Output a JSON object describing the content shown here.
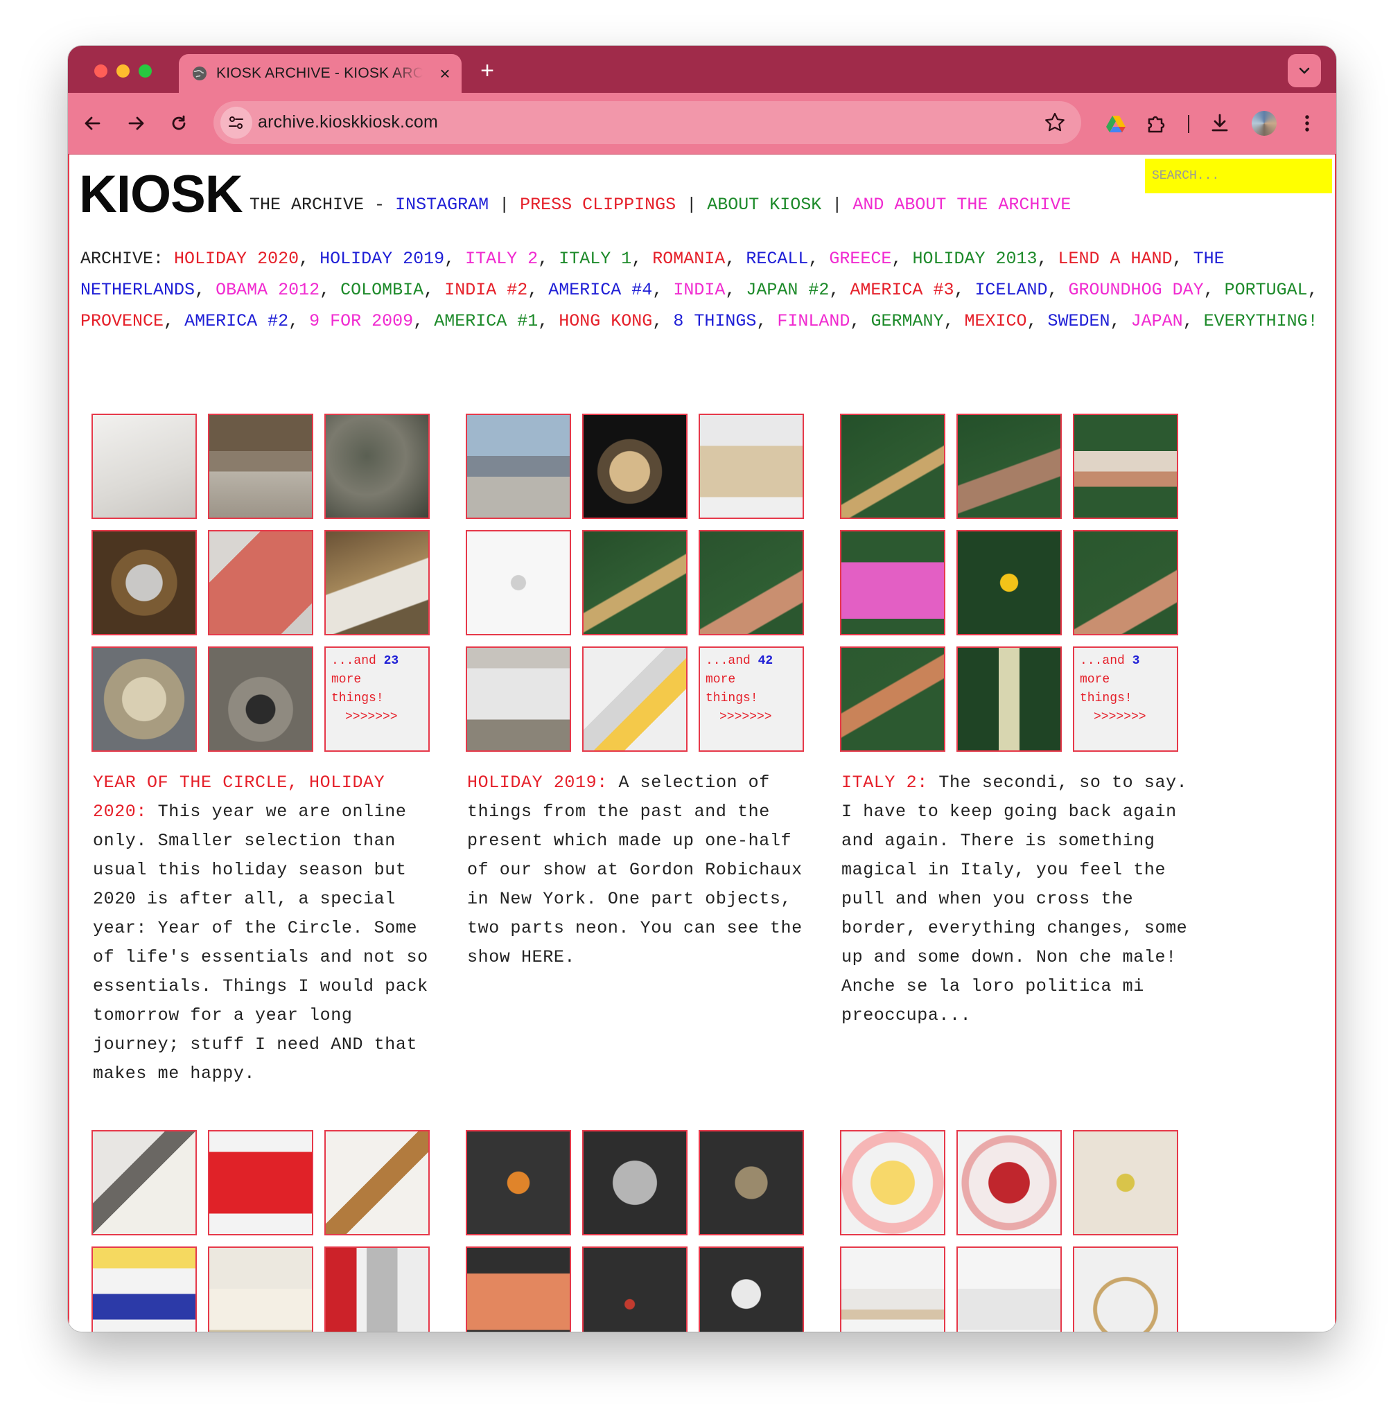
{
  "browser": {
    "tab_title": "KIOSK ARCHIVE - KIOSK ARCHIVE",
    "tab_close": "×",
    "new_tab": "+",
    "url": "archive.kioskkiosk.com"
  },
  "header": {
    "logo": "KIOSK",
    "subtitle": "THE ARCHIVE -",
    "links": [
      {
        "label": "INSTAGRAM",
        "color": "#1f1fd6"
      },
      {
        "label": "PRESS CLIPPINGS",
        "color": "#e5202a"
      },
      {
        "label": "ABOUT KIOSK",
        "color": "#1d8a2a"
      },
      {
        "label": "AND ABOUT THE ARCHIVE",
        "color": "#f02bd0"
      }
    ],
    "separator": "|",
    "search_placeholder": "SEARCH..."
  },
  "archive": {
    "label": "ARCHIVE:",
    "items": [
      {
        "label": "HOLIDAY 2020",
        "color": "#e5202a"
      },
      {
        "label": "HOLIDAY 2019",
        "color": "#1f1fd6"
      },
      {
        "label": "ITALY 2",
        "color": "#f02bd0"
      },
      {
        "label": "ITALY 1",
        "color": "#1d8a2a"
      },
      {
        "label": "ROMANIA",
        "color": "#e5202a"
      },
      {
        "label": "RECALL",
        "color": "#1f1fd6"
      },
      {
        "label": "GREECE",
        "color": "#f02bd0"
      },
      {
        "label": "HOLIDAY 2013",
        "color": "#1d8a2a"
      },
      {
        "label": "LEND A HAND",
        "color": "#e5202a"
      },
      {
        "label": "THE NETHERLANDS",
        "color": "#1f1fd6"
      },
      {
        "label": "OBAMA 2012",
        "color": "#f02bd0"
      },
      {
        "label": "COLOMBIA",
        "color": "#1d8a2a"
      },
      {
        "label": "INDIA #2",
        "color": "#e5202a"
      },
      {
        "label": "AMERICA #4",
        "color": "#1f1fd6"
      },
      {
        "label": "INDIA",
        "color": "#f02bd0"
      },
      {
        "label": "JAPAN #2",
        "color": "#1d8a2a"
      },
      {
        "label": "AMERICA #3",
        "color": "#e5202a"
      },
      {
        "label": "ICELAND",
        "color": "#1f1fd6"
      },
      {
        "label": "GROUNDHOG DAY",
        "color": "#f02bd0"
      },
      {
        "label": "PORTUGAL",
        "color": "#1d8a2a"
      },
      {
        "label": "PROVENCE",
        "color": "#e5202a"
      },
      {
        "label": "AMERICA #2",
        "color": "#1f1fd6"
      },
      {
        "label": "9 FOR 2009",
        "color": "#f02bd0"
      },
      {
        "label": "AMERICA #1",
        "color": "#1d8a2a"
      },
      {
        "label": "HONG KONG",
        "color": "#e5202a"
      },
      {
        "label": "8 THINGS",
        "color": "#1f1fd6"
      },
      {
        "label": "FINLAND",
        "color": "#f02bd0"
      },
      {
        "label": "GERMANY",
        "color": "#1d8a2a"
      },
      {
        "label": "MEXICO",
        "color": "#e5202a"
      },
      {
        "label": "SWEDEN",
        "color": "#1f1fd6"
      },
      {
        "label": "JAPAN",
        "color": "#f02bd0"
      },
      {
        "label": "EVERYTHING!",
        "color": "#1d8a2a"
      }
    ]
  },
  "collections": [
    {
      "heading": "YEAR OF THE CIRCLE, HOLIDAY 2020:",
      "text": " This year we are online only. Smaller selection than usual this holiday season but 2020 is after all, a special year: Year of the Circle. Some of life's essentials and not so essentials. Things I would pack tomorrow for a year long journey; stuff I need AND that makes me happy.",
      "more_prefix": "...and",
      "more_count": "23",
      "more_suffix": "more things!",
      "more_arrows": ">>>>>>>",
      "thumbs": [
        "linear-gradient(160deg,#f2f1ef,#dcdad6 60%,#c9c6c1)",
        "linear-gradient(180deg,#6b5a46 0 35%,#8a7c6b 35% 55%,#b9b3a8 55%,#9c9488)",
        "radial-gradient(circle at 40% 40%,#5a5f52,#7b7a6e 45%,#3e4238)",
        "radial-gradient(circle at 50% 50%,#c9c8c6 0 25%,#7a5b34 26% 45%,#4b3520 46%)",
        "linear-gradient(135deg,#d9d6d2 0 25%,#d46b5f 25% 85%,#cfccc8 85%)",
        "linear-gradient(160deg,#6a5236,#a38659 45%,#e8e4dc 46% 75%,#6b5a3f 76%)",
        "radial-gradient(circle at 50% 50%,#d9cfb3 0 30%,#a89c80 31% 55%,#6b6f74 56%)",
        "radial-gradient(circle at 50% 60%,#2b2b2b 0 18%,#8f8a80 19% 40%,#6e6a62 41%)",
        "more"
      ]
    },
    {
      "heading": "HOLIDAY 2019:",
      "text": " A selection of things from the past and the present which made up one-half of our show at Gordon Robichaux in New York. One part objects, two parts neon. You can see the show HERE.",
      "more_prefix": "...and",
      "more_count": "42",
      "more_suffix": "more things!",
      "more_arrows": ">>>>>>>",
      "thumbs": [
        "linear-gradient(180deg,#9fb7cc 0 40%,#7d8793 40% 60%,#b8b5ae 60%)",
        "radial-gradient(circle at 45% 55%,#d6b98a 0 25%,#5a4a36 26% 40%,#111 41%)",
        "linear-gradient(180deg,#e9e9ea 0 30%,#d9c7a6 30% 80%,#efefef 80%)",
        "radial-gradient(circle at 50% 50%,#cfcfcf 0 10%,#f7f7f7 11%)",
        "linear-gradient(150deg,#264e2a,#2f5d33 50%,#c8a86b 51% 62%,#2d5a31 63%)",
        "linear-gradient(150deg,#2a532e,#2f5e33 60%,#c98f70 61% 80%,#2b572f 81%)",
        "linear-gradient(180deg,#c7c3bd 0 20%,#e6e6e6 20% 70%,#8a8478 70%)",
        "linear-gradient(135deg,#efefef 0 40%,#d5d5d5 40% 55%,#f4c94a 55% 70%,#efefef 70%)",
        "more"
      ]
    },
    {
      "heading": "ITALY 2:",
      "text": " The secondi, so to say. I have to keep going back again and again. There is something magical in Italy, you feel the pull and when you cross the border, everything changes, some up and some down. Non che male! Anche se la loro politica mi preoccupa...",
      "more_prefix": "...and",
      "more_count": "3",
      "more_suffix": "more things!",
      "more_arrows": ">>>>>>>",
      "thumbs": [
        "linear-gradient(150deg,#24502a,#2e5b31 55%,#c9a66a 56% 66%,#2c5830 67%)",
        "linear-gradient(160deg,#24502a,#2d5a31 50%,#a77e66 51% 70%,#2b5830 71%)",
        "linear-gradient(180deg,#2c5930 0 35%,#e0d4c6 35% 55%,#c48b6d 55% 70%,#2c5930 70%)",
        "linear-gradient(180deg,#2c5930 0 30%,#e35fc4 30% 85%,#2c5930 85%)",
        "radial-gradient(circle at 50% 50%,#f2c319 0 12%,#1f4425 13%)",
        "linear-gradient(150deg,#2a572e,#2e5b31 60%,#c98f70 61% 80%,#2b572f 81%)",
        "linear-gradient(150deg,#2c5930,#2e5b31 40%,#c98359 41% 55%,#2c5930 56%)",
        "linear-gradient(90deg,#1f4425 0 40%,#d8d6b0 40% 60%,#1f4425 60%)",
        "more"
      ]
    }
  ],
  "bottom_rows": [
    [
      "linear-gradient(135deg,#e8e6e3 0 35%,#6a6763 35% 50%,#f1efe9 50%)",
      "linear-gradient(180deg,#f3f3f3 0 20%,#e02228 20% 80%,#f3f3f3 80%)",
      "linear-gradient(135deg,#f3f1ed 0 45%,#b27b3e 45% 60%,#f3f1ed 60%)",
      "linear-gradient(180deg,#f5d960 0 20%,#f3f3f3 20% 45%,#2c3aa8 45% 70%,#f3f3f3 70%)",
      "linear-gradient(180deg,#ece8df 0 40%,#f4efe4 40% 80%,#cfc2a3 80%)",
      "linear-gradient(90deg,#cc2229 0 30%,#f0f0f0 30% 40%,#b8b8b8 40% 70%,#ededed 70%)"
    ],
    [
      "radial-gradient(circle at 50% 50%,#e0842a 0 15%,#343434 16%)",
      "radial-gradient(circle at 50% 50%,#b5b5b5 0 30%,#2d2d2d 31%)",
      "radial-gradient(circle at 50% 50%,#9a8a6c 0 22%,#2f2f2f 23%)",
      "linear-gradient(180deg,#2f2f2f 0 25%,#e3875f 25% 80%,#2f2f2f 80%)",
      "radial-gradient(circle at 45% 55%,#c23b2f 0 6%,#2f2f2f 7%)",
      "radial-gradient(circle at 45% 45%,#e9e9e9 0 18%,#2f2f2f 19%)"
    ],
    [
      "radial-gradient(circle at 50% 50%,#f7d86a 0 30%,#f2f2f2 31% 55%,#f6b6b6 56% 70%,#f2f2f2 71%)",
      "radial-gradient(circle at 50% 50%,#c0262d 0 28%,#f3eaea 29% 55%,#e9a9a9 56% 65%,#f3f3f3 66%)",
      "radial-gradient(circle at 50% 50%,#d9c44a 0 12%,#eae2d6 13%)",
      "linear-gradient(180deg,#f4f4f4 0 40%,#e9e7e4 40% 60%,#d7c4a8 60% 70%,#f4f4f4 70%)",
      "linear-gradient(180deg,#f5f5f5 0 40%,#e6e6e6 40% 80%,#f5f5f5 80%)",
      "radial-gradient(circle at 50% 60%,#efefef 0 35%,#c9a66a 36% 40%,#f0f0f0 41%)"
    ]
  ]
}
